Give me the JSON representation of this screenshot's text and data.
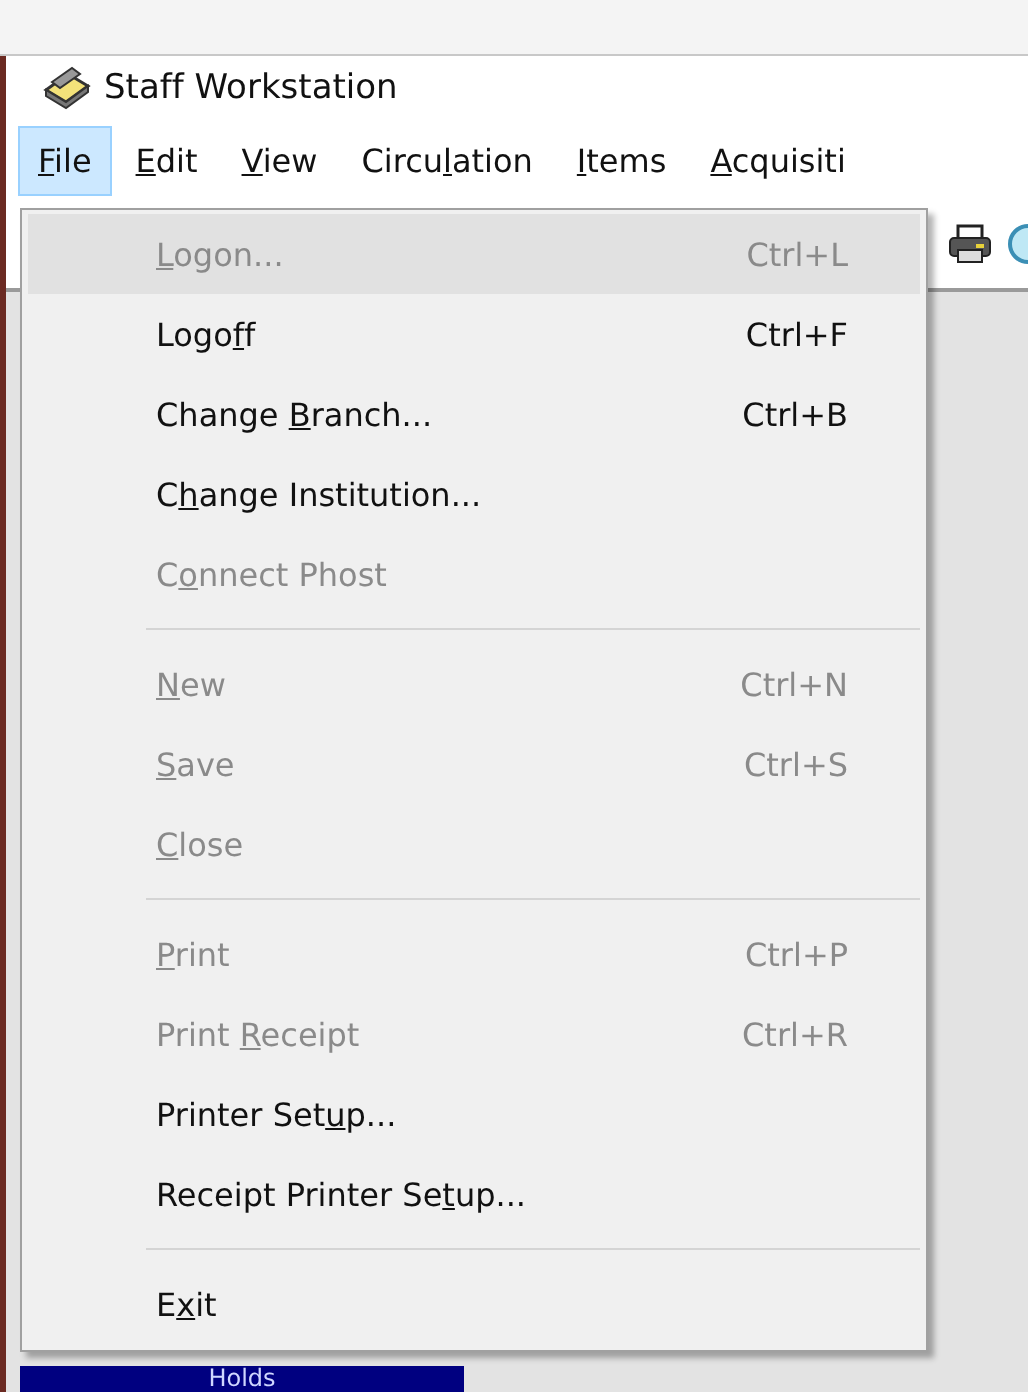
{
  "window": {
    "title": "Staff Workstation"
  },
  "menu_bar": [
    {
      "key": "F",
      "after": "ile",
      "selected": true
    },
    {
      "key": "E",
      "after": "dit",
      "selected": false
    },
    {
      "key": "V",
      "after": "iew",
      "selected": false
    },
    {
      "before": "Circu",
      "key": "l",
      "after": "ation",
      "selected": false
    },
    {
      "key": "I",
      "after": "tems",
      "selected": false
    },
    {
      "key": "A",
      "after": "cquisiti",
      "selected": false
    }
  ],
  "file_menu": [
    {
      "kind": "item",
      "key": "L",
      "after": "ogon...",
      "shortcut": "Ctrl+L",
      "disabled": true,
      "highlighted": true
    },
    {
      "kind": "item",
      "before": "Logo",
      "key": "f",
      "after": "f",
      "shortcut": "Ctrl+F",
      "disabled": false,
      "highlighted": false
    },
    {
      "kind": "item",
      "before": "Change ",
      "key": "B",
      "after": "ranch...",
      "shortcut": "Ctrl+B",
      "disabled": false,
      "highlighted": false
    },
    {
      "kind": "item",
      "before": "C",
      "key": "h",
      "after": "ange Institution...",
      "disabled": false,
      "highlighted": false
    },
    {
      "kind": "item",
      "before": "C",
      "key": "o",
      "after": "nnect Phost",
      "disabled": true,
      "highlighted": false
    },
    {
      "kind": "separator"
    },
    {
      "kind": "item",
      "key": "N",
      "after": "ew",
      "shortcut": "Ctrl+N",
      "disabled": true,
      "highlighted": false
    },
    {
      "kind": "item",
      "key": "S",
      "after": "ave",
      "shortcut": "Ctrl+S",
      "disabled": true,
      "highlighted": false
    },
    {
      "kind": "item",
      "key": "C",
      "after": "lose",
      "disabled": true,
      "highlighted": false
    },
    {
      "kind": "separator"
    },
    {
      "kind": "item",
      "key": "P",
      "after": "rint",
      "shortcut": "Ctrl+P",
      "disabled": true,
      "highlighted": false
    },
    {
      "kind": "item",
      "before": "Print ",
      "key": "R",
      "after": "eceipt",
      "shortcut": "Ctrl+R",
      "disabled": true,
      "highlighted": false
    },
    {
      "kind": "item",
      "before": "Printer Set",
      "key": "u",
      "after": "p...",
      "disabled": false,
      "highlighted": false
    },
    {
      "kind": "item",
      "before": "Receipt Printer Se",
      "key": "t",
      "after": "up...",
      "disabled": false,
      "highlighted": false
    },
    {
      "kind": "separator"
    },
    {
      "kind": "item",
      "before": "E",
      "key": "x",
      "after": "it",
      "disabled": false,
      "highlighted": false
    }
  ],
  "sidebar": {
    "button": "Holds"
  }
}
